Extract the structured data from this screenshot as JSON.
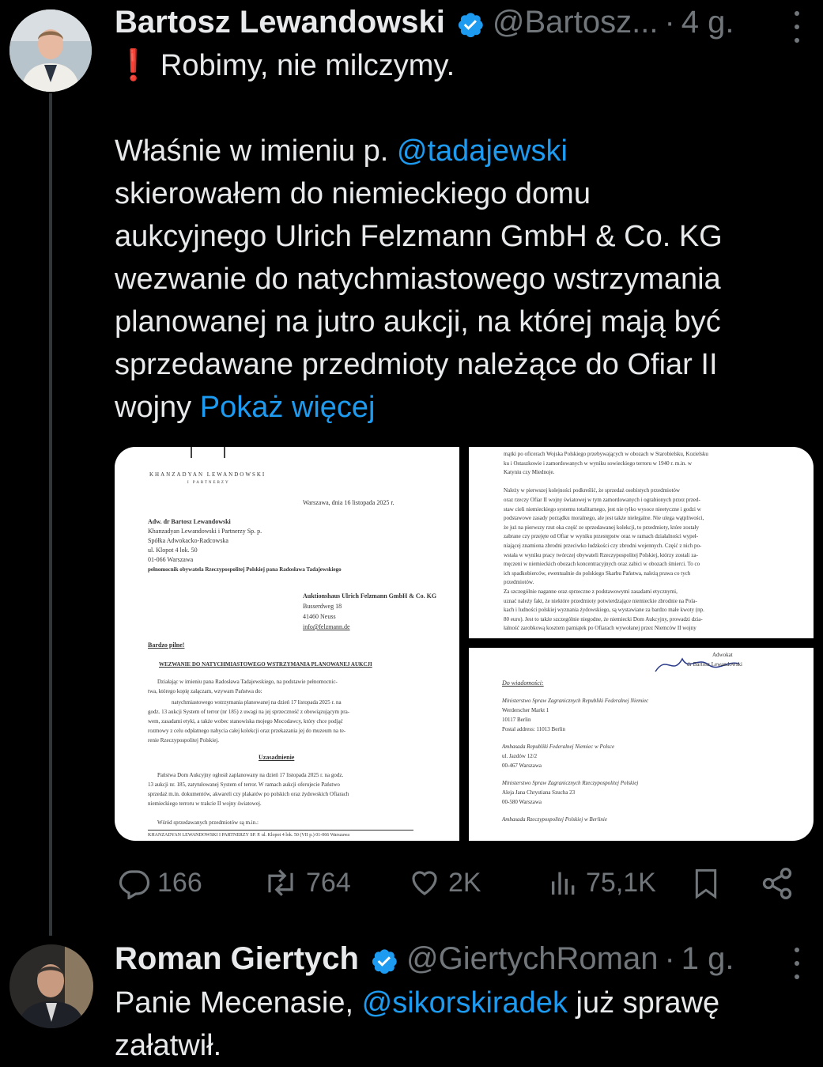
{
  "tweet1": {
    "author_name": "Bartosz Lewandowski",
    "handle": "@Bartosz...",
    "separator": "·",
    "time": "4 g.",
    "text_lines": [
      "❗ Robimy, nie milczymy.",
      "",
      "Właśnie w imieniu p. @tadajewski",
      "skierowałem do niemieckiego domu",
      "aukcyjnego Ulrich Felzmann GmbH & Co. KG",
      "wezwanie do natychmiastowego wstrzymania",
      "planowanej na jutro aukcji, na której mają być",
      "sprzedawane przedmioty należące do Ofiar II",
      "wojny"
    ],
    "mention": "@tadajewski",
    "line3_prefix": "Właśnie w imieniu p. ",
    "line1_emoji": "❗",
    "line1_text": "Robimy, nie milczymy.",
    "last_line_prefix": "wojny ",
    "show_more": "Pokaż więcej",
    "doc_left": {
      "logo_name": "KHANZADYAN LEWANDOWSKI",
      "logo_sub": "I PARTNERZY",
      "date_line": "Warszawa, dnia 16 listopada 2025 r.",
      "sender": [
        "Adw. dr Bartosz Lewandowski",
        "Khanzadyan Lewandowski i Partnerzy Sp. p.",
        "Spółka Adwokacko-Radcowska",
        "ul. Klopot 4 lok. 50",
        "01-066 Warszawa"
      ],
      "sender_bold": "pełnomocnik obywatela Rzeczypospolitej Polskiej pana Radosława Tadajewskiego",
      "recipient": [
        "Auktionshaus Ulrich Felzmann GmbH & Co. KG",
        "Busserdweg 18",
        "41460 Neuss",
        "info@felzmann.de"
      ],
      "urgent": "Bardzo pilne!",
      "title": "WEZWANIE DO NATYCHMIASTOWEGO WSTRZYMANIA PLANOWANEJ AUKCJI",
      "para1": [
        "Działając w imieniu pana Radosława Tadajewskiego, na podstawie pełnomocnic-",
        "twa, którego kopię załączam, wzywam Państwa do:",
        "natychmiastowego wstrzymania planowanej na dzień 17 listopada 2025 r. na",
        "godz. 13 aukcji System of terror (nr 185) z uwagi na jej sprzeczność z obowiązującym pra-",
        "wem, zasadami etyki, a także wobec stanowiska mojego Mocodawcy, który chce podjąć",
        "rozmowy z celu odpłatnego nabycia całej kolekcji oraz przekazania jej do muzeum na te-",
        "renie Rzeczypospolitej Polskiej."
      ],
      "heading2": "Uzasadnienie",
      "para2": [
        "Państwa Dom Aukcyjny ogłosił zaplanowany na dzień 17 listopada 2025 r. na godz.",
        "13 aukcji nr. 185, zatytułowanej System of terror. W ramach aukcji oferujecie Państwo",
        "sprzedaż m.in. dokumentów, akwareli czy plakatów po polskich oraz żydowskich Ofiarach",
        "niemieckiego terroru w trakcie II wojny światowej."
      ],
      "para3": "Wśród sprzedawanych przedmiotów są m.in.:",
      "footer": "KHANZADYAN LEWANDOWSKI I PARTNERZY SP. P. ul. Klopot 4 lok. 50 (VII p.) 01-066 Warszawa"
    },
    "doc_right_top": {
      "lines": [
        "mątki po oficerach Wojska Polskiego przebywających w obozach w Starobielsku, Kozielsku",
        "ku i Ostaszkowie i zamordowanych w wyniku sowieckiego terroru w 1940 r. m.in. w",
        "Katyniu czy Miednoje.",
        "",
        "Należy w pierwszej kolejności podkreślić, że sprzedaż osobistych przedmiotów",
        "oraz rzeczy Ofiar II wojny światowej w tym zamordowanych i ograbionych przez przed-",
        "staw cieli niemieckiego systemu totalitarnego, jest nie tylko wysoce nieetyczne i godzi w",
        "podstawowe zasady porządku moralnego, ale jest także nielegalne. Nie ulega wątpliwości,",
        "że już na pierwszy rzut oka część ze sprzedawanej kolekcji, to przedmioty, które zostały",
        "zabrane czy przejęte od Ofiar w wyniku przestępstw oraz w ramach działalności wypeł-",
        "niającej znamiona zbrodni przeciwko ludzkości czy zbrodni wojennych. Część z nich po-",
        "wstała w wyniku pracy twórczej obywateli Rzeczypospolitej Polskiej, którzy zostali za-",
        "męczeni w niemieckich obozach koncentracyjnych oraz zabici w obozach śmierci. To co",
        "ich spadkobierców, ewentualnie do polskiego Skarbu Państwa, należą prawa co tych",
        "przedmiotów.",
        "Za szczególnie naganne oraz sprzeczne z podstawowymi zasadami etycznymi,",
        "uznać należy fakt, że niektóre przedmioty potwierdzające niemieckie zbrodnie na Pola-",
        "kach i ludności polskiej wyznania żydowskiego, są wystawiane za bardzo małe kwoty (np.",
        "80 euro). Jest to także szczególnie niegodne, że niemiecki Dom Aukcyjny, prowadzi dzia-",
        "łalność zarobkową kosztem pamiątek po Ofiarach wywołanej przez Niemców II wojny"
      ]
    },
    "doc_right_bottom": {
      "signature_label": "Adwokat",
      "signature_name": "dr Bartosz Lewandowski",
      "to_know": "Do wiadomości:",
      "blocks": [
        [
          "Ministerstwo Spraw Zagranicznych Republiki Federalnej Niemiec",
          "Werderscher Markt 1",
          "10117 Berlin",
          "Postal address: 11013 Berlin"
        ],
        [
          "Ambasada Republiki Federalnej Niemiec w Polsce",
          "ul. Jazdów 12/2",
          "00-467 Warszawa"
        ],
        [
          "Ministerstwo Spraw Zagranicznych Rzeczypospolitej Polskiej",
          "Aleja Jana Chrystiana Szucha 23",
          "00-580 Warszawa"
        ],
        [
          "Ambasada Rzeczypospolitej Polskiej w Berlinie"
        ]
      ]
    },
    "actions": {
      "replies": "166",
      "retweets": "764",
      "likes": "2K",
      "views": "75,1K"
    }
  },
  "tweet2": {
    "author_name": "Roman Giertych",
    "handle": "@GiertychRoman",
    "separator": "·",
    "time": "1 g.",
    "line1_prefix": "Panie Mecenasie, ",
    "mention": "@sikorskiradek",
    "line1_suffix": " już sprawę",
    "line2": "załatwił."
  },
  "colors": {
    "background": "#000000",
    "text": "#e7e9ea",
    "secondary": "#71767b",
    "link": "#1d9bf0",
    "verified": "#1d9bf0"
  }
}
